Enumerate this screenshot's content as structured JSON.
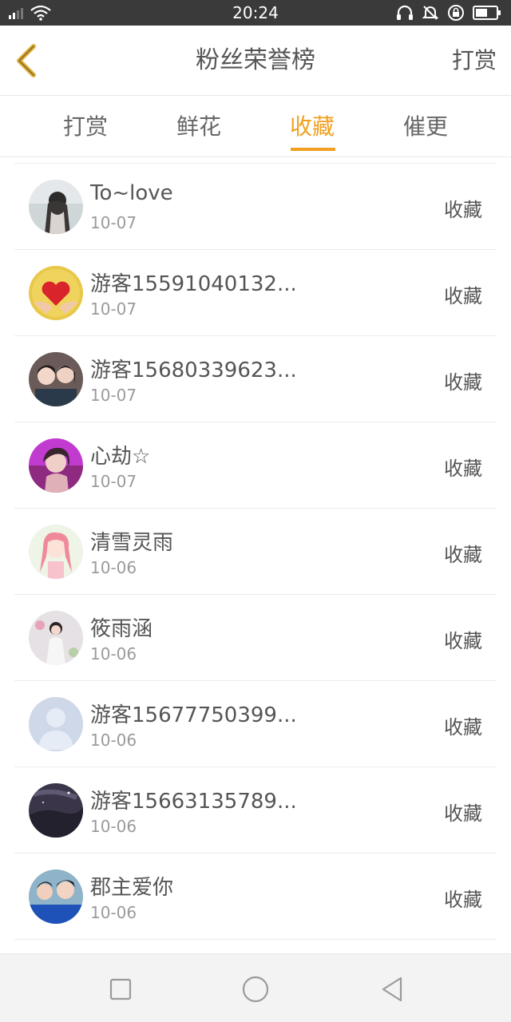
{
  "status": {
    "time": "20:24"
  },
  "header": {
    "title": "粉丝荣誉榜",
    "action_label": "打赏"
  },
  "tabs": [
    {
      "label": "打赏"
    },
    {
      "label": "鲜花"
    },
    {
      "label": "收藏"
    },
    {
      "label": "催更"
    }
  ],
  "active_tab_index": 2,
  "colors": {
    "accent": "#f0a020",
    "text": "#555555",
    "muted": "#9a9a9a"
  },
  "rows": [
    {
      "name": "To~love",
      "date": "10-07",
      "type": "收藏",
      "avatar": "avatar-portrait-dark-icon"
    },
    {
      "name": "游客15591040132...",
      "date": "10-07",
      "type": "收藏",
      "avatar": "avatar-heart-hands-icon"
    },
    {
      "name": "游客15680339623...",
      "date": "10-07",
      "type": "收藏",
      "avatar": "avatar-two-girls-icon"
    },
    {
      "name": "心劫☆",
      "date": "10-07",
      "type": "收藏",
      "avatar": "avatar-pink-portrait-icon"
    },
    {
      "name": "清雪灵雨",
      "date": "10-06",
      "type": "收藏",
      "avatar": "avatar-anime-girl-icon"
    },
    {
      "name": "筱雨涵",
      "date": "10-06",
      "type": "收藏",
      "avatar": "avatar-couple-icon"
    },
    {
      "name": "游客15677750399...",
      "date": "10-06",
      "type": "收藏",
      "avatar": "default-user-avatar-icon"
    },
    {
      "name": "游客15663135789...",
      "date": "10-06",
      "type": "收藏",
      "avatar": "avatar-night-sky-icon"
    },
    {
      "name": "郡主爱你",
      "date": "10-06",
      "type": "收藏",
      "avatar": "avatar-group-photo-icon"
    }
  ],
  "nav": {
    "icons": [
      "square-recents-icon",
      "circle-home-icon",
      "triangle-back-icon"
    ]
  }
}
